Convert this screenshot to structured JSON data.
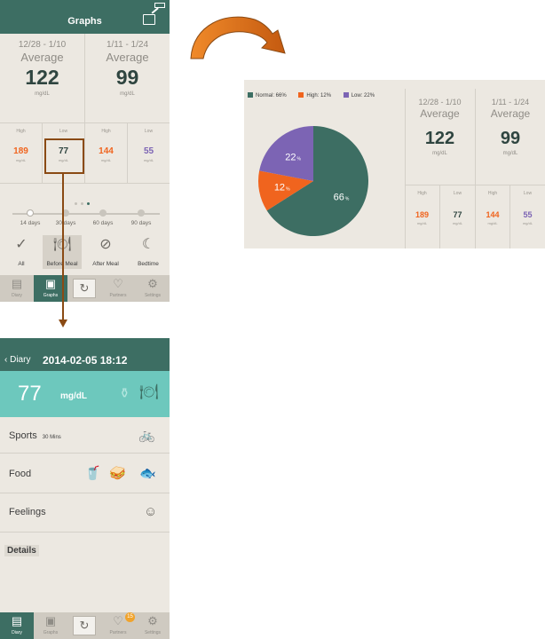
{
  "colors": {
    "teal": "#3d6e63",
    "orange": "#f0641e",
    "purple": "#7c64b4",
    "light_teal": "#6dc8bd",
    "accent_brown": "#8a4a14"
  },
  "graphs": {
    "title": "Graphs",
    "periods": [
      {
        "range": "12/28 - 1/10",
        "avg_label": "Average",
        "value": "122",
        "unit": "mg/dL"
      },
      {
        "range": "1/11 - 1/24",
        "avg_label": "Average",
        "value": "99",
        "unit": "mg/dL"
      }
    ],
    "small": [
      {
        "label": "High",
        "value": "189",
        "unit": "mg/dL",
        "color": "#f0641e"
      },
      {
        "label": "Low",
        "value": "77",
        "unit": "mg/dL",
        "color": "#2f4540"
      },
      {
        "label": "High",
        "value": "144",
        "unit": "mg/dL",
        "color": "#f0641e"
      },
      {
        "label": "Low",
        "value": "55",
        "unit": "mg/dL",
        "color": "#7c64b4"
      }
    ],
    "days": [
      "14 days",
      "30 days",
      "60 days",
      "90 days"
    ],
    "selected_days": "14 days",
    "meals": [
      {
        "label": "All",
        "icon": "checkmark-icon"
      },
      {
        "label": "Before Meal",
        "icon": "plate-icon"
      },
      {
        "label": "After Meal",
        "icon": "empty-plate-icon"
      },
      {
        "label": "Bedtime",
        "icon": "moon-icon"
      }
    ],
    "selected_meal": "Before Meal"
  },
  "tabs": [
    "Diary",
    "Graphs",
    "",
    "Partners",
    "Settings"
  ],
  "chart_data": {
    "type": "pie",
    "categories": [
      "Normal",
      "High",
      "Low"
    ],
    "values": [
      66,
      12,
      22
    ],
    "colors": [
      "#3d6e63",
      "#f0641e",
      "#7c64b4"
    ],
    "legend": [
      "Normal: 66%",
      "High: 12%",
      "Low: 22%"
    ],
    "slice_labels": [
      "66",
      "12",
      "22"
    ],
    "slice_label_unit": "%",
    "legend_position": "top-left"
  },
  "diary": {
    "back_label": "Diary",
    "datetime": "2014-02-05 18:12",
    "value": "77",
    "unit": "mg/dL",
    "rows": [
      {
        "label": "Sports",
        "sub": "30 Mins"
      },
      {
        "label": "Food",
        "sub": ""
      },
      {
        "label": "Feelings",
        "sub": ""
      },
      {
        "label": "Details",
        "sub": ""
      }
    ],
    "partners_badge": "15"
  }
}
